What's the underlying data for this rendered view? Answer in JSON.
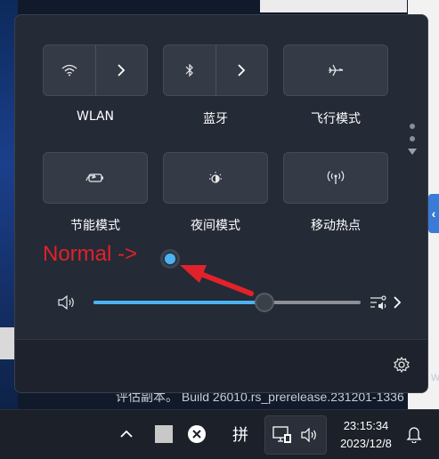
{
  "quick_settings": {
    "tiles": [
      {
        "id": "wlan",
        "label": "WLAN",
        "icon": "wifi-icon",
        "has_chevron": true
      },
      {
        "id": "bluetooth",
        "label": "蓝牙",
        "icon": "bluetooth-icon",
        "has_chevron": true
      },
      {
        "id": "airplane",
        "label": "飞行模式",
        "icon": "airplane-icon",
        "has_chevron": false
      },
      {
        "id": "battery-saver",
        "label": "节能模式",
        "icon": "battery-saver-icon",
        "has_chevron": false
      },
      {
        "id": "night-light",
        "label": "夜间模式",
        "icon": "night-light-icon",
        "has_chevron": false
      },
      {
        "id": "hotspot",
        "label": "移动热点",
        "icon": "hotspot-icon",
        "has_chevron": false
      }
    ],
    "volume": {
      "level_percent": 64,
      "icon": "speaker-icon",
      "output_icon": "audio-output-icon"
    },
    "settings_icon": "gear-icon"
  },
  "annotation": {
    "text": "Normal ->",
    "color": "#e0222a"
  },
  "desktop": {
    "watermark": "评估副本。 Build 26010.rs_prerelease.231201-1336",
    "watermark_tail": "w"
  },
  "taskbar": {
    "ime_label": "拼",
    "time": "23:15:34",
    "date": "2023/12/8"
  },
  "colors": {
    "accent": "#4cb3f2",
    "panel": "#242a36",
    "taskbar": "#1c2029"
  }
}
